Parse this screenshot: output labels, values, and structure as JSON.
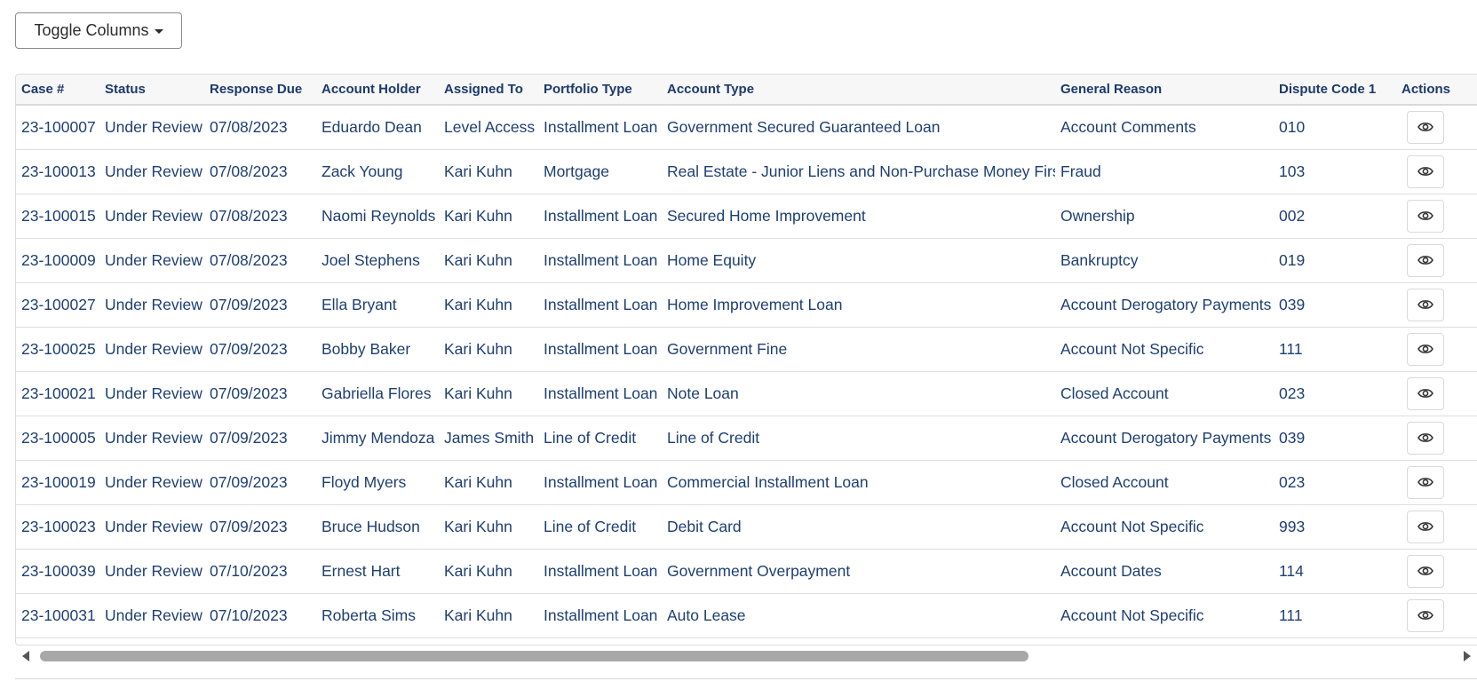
{
  "toolbar": {
    "toggle_columns_label": "Toggle Columns"
  },
  "table": {
    "headers": {
      "case": "Case #",
      "status": "Status",
      "response_due": "Response Due",
      "account_holder": "Account Holder",
      "assigned_to": "Assigned To",
      "portfolio_type": "Portfolio Type",
      "account_type": "Account Type",
      "general_reason": "General Reason",
      "dispute_code_1": "Dispute Code 1",
      "actions": "Actions"
    },
    "rows": [
      {
        "case": "23-100007",
        "status": "Under Review",
        "response_due": "07/08/2023",
        "account_holder": "Eduardo Dean",
        "assigned_to": "Level Access",
        "portfolio_type": "Installment Loan",
        "account_type": "Government Secured Guaranteed Loan",
        "general_reason": "Account Comments",
        "dispute_code_1": "010"
      },
      {
        "case": "23-100013",
        "status": "Under Review",
        "response_due": "07/08/2023",
        "account_holder": "Zack Young",
        "assigned_to": "Kari Kuhn",
        "portfolio_type": "Mortgage",
        "account_type": "Real Estate - Junior Liens and Non-Purchase Money First",
        "general_reason": "Fraud",
        "dispute_code_1": "103"
      },
      {
        "case": "23-100015",
        "status": "Under Review",
        "response_due": "07/08/2023",
        "account_holder": "Naomi Reynolds",
        "assigned_to": "Kari Kuhn",
        "portfolio_type": "Installment Loan",
        "account_type": "Secured Home Improvement",
        "general_reason": "Ownership",
        "dispute_code_1": "002"
      },
      {
        "case": "23-100009",
        "status": "Under Review",
        "response_due": "07/08/2023",
        "account_holder": "Joel Stephens",
        "assigned_to": "Kari Kuhn",
        "portfolio_type": "Installment Loan",
        "account_type": "Home Equity",
        "general_reason": "Bankruptcy",
        "dispute_code_1": "019"
      },
      {
        "case": "23-100027",
        "status": "Under Review",
        "response_due": "07/09/2023",
        "account_holder": "Ella Bryant",
        "assigned_to": "Kari Kuhn",
        "portfolio_type": "Installment Loan",
        "account_type": "Home Improvement Loan",
        "general_reason": "Account Derogatory Payments",
        "dispute_code_1": "039"
      },
      {
        "case": "23-100025",
        "status": "Under Review",
        "response_due": "07/09/2023",
        "account_holder": "Bobby Baker",
        "assigned_to": "Kari Kuhn",
        "portfolio_type": "Installment Loan",
        "account_type": "Government Fine",
        "general_reason": "Account Not Specific",
        "dispute_code_1": "111"
      },
      {
        "case": "23-100021",
        "status": "Under Review",
        "response_due": "07/09/2023",
        "account_holder": "Gabriella Flores",
        "assigned_to": "Kari Kuhn",
        "portfolio_type": "Installment Loan",
        "account_type": "Note Loan",
        "general_reason": "Closed Account",
        "dispute_code_1": "023"
      },
      {
        "case": "23-100005",
        "status": "Under Review",
        "response_due": "07/09/2023",
        "account_holder": "Jimmy Mendoza",
        "assigned_to": "James Smith",
        "portfolio_type": "Line of Credit",
        "account_type": "Line of Credit",
        "general_reason": "Account Derogatory Payments",
        "dispute_code_1": "039"
      },
      {
        "case": "23-100019",
        "status": "Under Review",
        "response_due": "07/09/2023",
        "account_holder": "Floyd Myers",
        "assigned_to": "Kari Kuhn",
        "portfolio_type": "Installment Loan",
        "account_type": "Commercial Installment Loan",
        "general_reason": "Closed Account",
        "dispute_code_1": "023"
      },
      {
        "case": "23-100023",
        "status": "Under Review",
        "response_due": "07/09/2023",
        "account_holder": "Bruce Hudson",
        "assigned_to": "Kari Kuhn",
        "portfolio_type": "Line of Credit",
        "account_type": "Debit Card",
        "general_reason": "Account Not Specific",
        "dispute_code_1": "993"
      },
      {
        "case": "23-100039",
        "status": "Under Review",
        "response_due": "07/10/2023",
        "account_holder": "Ernest Hart",
        "assigned_to": "Kari Kuhn",
        "portfolio_type": "Installment Loan",
        "account_type": "Government Overpayment",
        "general_reason": "Account Dates",
        "dispute_code_1": "114"
      },
      {
        "case": "23-100031",
        "status": "Under Review",
        "response_due": "07/10/2023",
        "account_holder": "Roberta Sims",
        "assigned_to": "Kari Kuhn",
        "portfolio_type": "Installment Loan",
        "account_type": "Auto Lease",
        "general_reason": "Account Not Specific",
        "dispute_code_1": "111"
      }
    ]
  },
  "icons": {
    "caret": "caret-down-icon",
    "view": "eye-icon",
    "scroll_left": "arrow-left-icon",
    "scroll_right": "arrow-right-icon"
  },
  "colors": {
    "header_text": "#1d3a6b",
    "cell_text": "#1d3f72"
  }
}
